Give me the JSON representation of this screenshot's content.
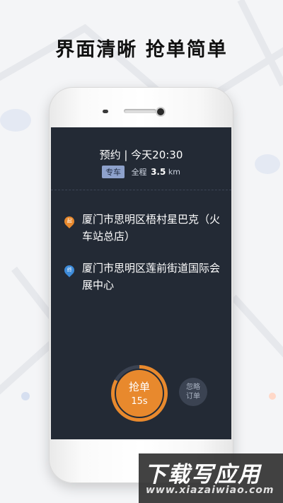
{
  "headline": "界面清晰  抢单简单",
  "order": {
    "appointment": "预约 | 今天20:30",
    "car_type": "专车",
    "distance_label": "全程",
    "distance_value": "3.5",
    "distance_unit": "km"
  },
  "route": {
    "start_pin": "起",
    "start_address": "厦门市思明区梧村星巴克（火车站总店）",
    "end_pin": "终",
    "end_address": "厦门市思明区莲前街道国际会展中心"
  },
  "actions": {
    "grab_label": "抢单",
    "grab_countdown": "15s",
    "grab_progress": 0.83,
    "ignore_line1": "忽略",
    "ignore_line2": "订单"
  },
  "watermark": {
    "title": "下载写应用",
    "url": "www.xiazaiwiao.com"
  },
  "colors": {
    "screen_bg": "#232a35",
    "accent_orange": "#e8892d",
    "end_blue": "#3d8bd9",
    "tag_bg": "#8ea2cc"
  }
}
